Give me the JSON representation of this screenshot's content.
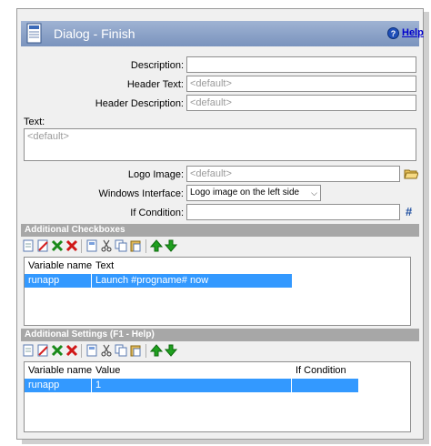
{
  "dialog": {
    "title": "Dialog - Finish",
    "help_label": "Help"
  },
  "form": {
    "description": {
      "label": "Description:",
      "value": ""
    },
    "header_text": {
      "label": "Header Text:",
      "placeholder": "<default>"
    },
    "header_description": {
      "label": "Header Description:",
      "placeholder": "<default>"
    },
    "text": {
      "label": "Text:",
      "placeholder": "<default>"
    },
    "logo_image": {
      "label": "Logo Image:",
      "placeholder": "<default>"
    },
    "windows_interface": {
      "label": "Windows Interface:",
      "value": "Logo image on the left side"
    },
    "if_condition": {
      "label": "If Condition:",
      "value": "",
      "hash_label": "#"
    }
  },
  "checkboxes": {
    "section_title": "Additional Checkboxes",
    "columns": [
      "Variable name",
      "Text"
    ],
    "rows": [
      {
        "variable": "runapp",
        "text": "Launch #progname# now"
      }
    ]
  },
  "settings": {
    "section_title": "Additional Settings (F1 - Help)",
    "columns": [
      "Variable name",
      "Value",
      "If Condition"
    ],
    "rows": [
      {
        "variable": "runapp",
        "value": "1",
        "condition": ""
      }
    ]
  },
  "toolbar_icons": [
    "new-icon",
    "edit-icon",
    "add-icon",
    "delete-icon",
    "document-icon",
    "cut-icon",
    "copy-icon",
    "paste-icon",
    "move-up-icon",
    "move-down-icon"
  ],
  "colors": {
    "title_bar": "#8aa0c8",
    "selection": "#3399ff",
    "section": "#a7a7a7",
    "help_link": "#0000cc"
  }
}
